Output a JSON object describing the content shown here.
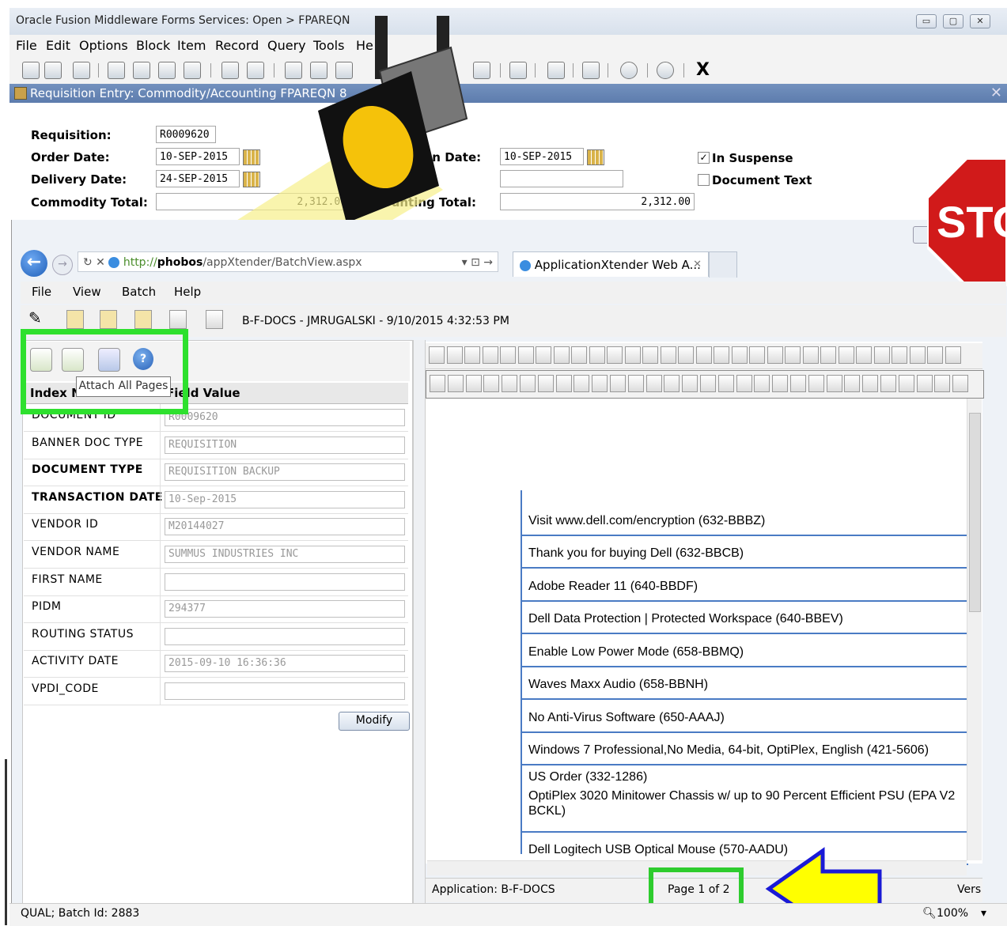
{
  "window": {
    "title": "Oracle Fusion Middleware Forms Services:  Open > FPAREQN",
    "buttons": [
      "▭",
      "▢",
      "✕"
    ]
  },
  "menu": [
    "File",
    "Edit",
    "Options",
    "Block",
    "Item",
    "Record",
    "Query",
    "Tools",
    "He"
  ],
  "toolbar": {
    "exit_label": "X"
  },
  "form": {
    "title": "Requisition Entry: Commodity/Accounting   FPAREQN  8",
    "requisition_label": "Requisition:",
    "requisition_value": "R0009620",
    "order_date_label": "Order Date:",
    "order_date_value": "10-SEP-2015",
    "delivery_date_label": "Delivery Date:",
    "delivery_date_value": "24-SEP-2015",
    "commodity_total_label": "Commodity Total:",
    "commodity_total_value": "2,312.00",
    "tran_date_label": "on Date:",
    "tran_date_value": "10-SEP-2015",
    "accounting_total_label": "Accounting Total:",
    "accounting_total_value": "2,312.00",
    "in_suspense_label": "In Suspense",
    "in_suspense_checked": "✓",
    "document_text_label": "Document Text",
    "blank_colon": ":"
  },
  "stop_sign": "STO",
  "browser": {
    "url_prefix": "http://",
    "url_host": "phobos",
    "url_path": "/appXtender/BatchView.aspx",
    "tab_title": "ApplicationXtender Web A...",
    "tab_close": "✕"
  },
  "ax": {
    "menu": [
      "File",
      "View",
      "Batch",
      "Help"
    ],
    "batch_title": "B-F-DOCS - JMRUGALSKI - 9/10/2015 4:32:53 PM",
    "tooltip": "Attach All Pages",
    "col_index": "Index Name",
    "col_field": "Field Value",
    "rows": [
      {
        "key": "DOCUMENT ID",
        "value": "R0009620"
      },
      {
        "key": "BANNER DOC TYPE",
        "value": "REQUISITION"
      },
      {
        "key": "DOCUMENT TYPE",
        "value": "REQUISITION BACKUP"
      },
      {
        "key": "TRANSACTION DATE",
        "value": "10-Sep-2015"
      },
      {
        "key": "VENDOR ID",
        "value": "M20144027"
      },
      {
        "key": "VENDOR NAME",
        "value": "SUMMUS INDUSTRIES INC"
      },
      {
        "key": "FIRST NAME",
        "value": ""
      },
      {
        "key": "PIDM",
        "value": "294377"
      },
      {
        "key": "ROUTING STATUS",
        "value": ""
      },
      {
        "key": "ACTIVITY DATE",
        "value": "2015-09-10 16:36:36"
      },
      {
        "key": "VPDI_CODE",
        "value": ""
      }
    ],
    "modify_label": "Modify",
    "doc_lines": [
      "Visit www.dell.com/encryption (632-BBBZ)",
      "Thank you for buying Dell (632-BBCB)",
      "Adobe Reader 11 (640-BBDF)",
      "Dell Data Protection | Protected Workspace (640-BBEV)",
      "Enable Low Power Mode (658-BBMQ)",
      "Waves Maxx Audio (658-BBNH)",
      "No Anti-Virus Software (650-AAAJ)",
      "Windows 7 Professional,No Media, 64-bit, OptiPlex, English (421-5606)",
      "US Order (332-1286)",
      "OptiPlex 3020 Minitower Chassis w/ up to 90 Percent Efficient PSU (EPA V2",
      "BCKL)",
      "Dell Logitech USB Optical Mouse (570-AADU)"
    ],
    "application_status": "Application: B-F-DOCS",
    "page_status": "Page 1 of 2",
    "vers_label": "Vers"
  },
  "bottom": {
    "batch_id": "QUAL; Batch Id: 2883",
    "zoom": "100%"
  }
}
